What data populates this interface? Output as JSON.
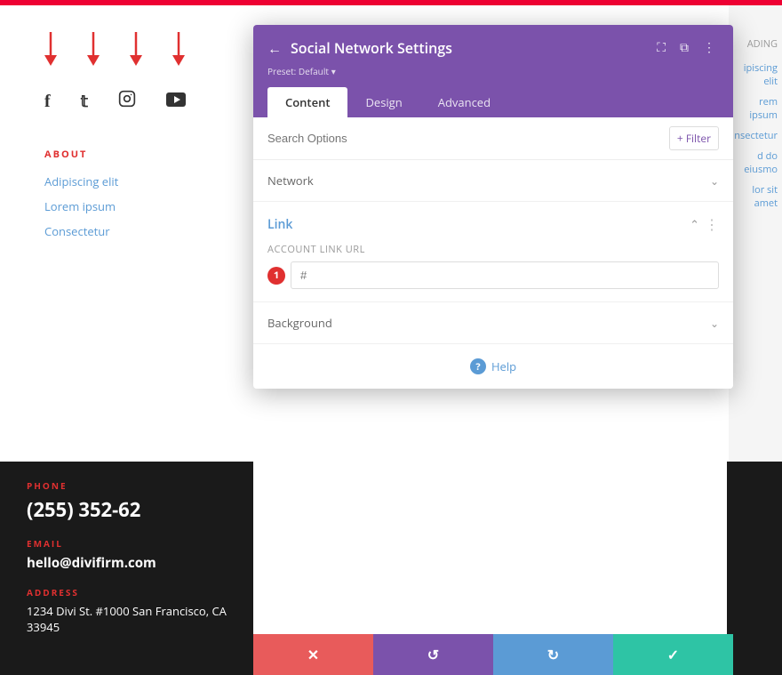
{
  "page": {
    "top_bar_color": "#e03030"
  },
  "modal": {
    "title": "Social Network Settings",
    "back_icon": "←",
    "preset_label": "Preset: Default",
    "preset_arrow": "▾",
    "header_icons": [
      "⛶",
      "⧉",
      "⋮"
    ],
    "tabs": [
      {
        "id": "content",
        "label": "Content",
        "active": true
      },
      {
        "id": "design",
        "label": "Design",
        "active": false
      },
      {
        "id": "advanced",
        "label": "Advanced",
        "active": false
      }
    ],
    "search_placeholder": "Search Options",
    "filter_label": "+ Filter",
    "sections": {
      "network": {
        "label": "Network",
        "open": false,
        "chevron": "⌄"
      },
      "link": {
        "label": "Link",
        "open": true,
        "chevron_open": "⌃",
        "more_icon": "⋮",
        "field_label": "Account Link URL",
        "field_number": "1",
        "field_value": "",
        "field_placeholder": "#"
      },
      "background": {
        "label": "Background",
        "open": false,
        "chevron": "⌄"
      }
    },
    "help_label": "Help"
  },
  "action_bar": {
    "cancel_icon": "✕",
    "undo_icon": "↺",
    "redo_icon": "↻",
    "save_icon": "✓"
  },
  "left_panel": {
    "about_title": "ABOUT",
    "links": [
      "Adipiscing elit",
      "Lorem ipsum",
      "Consectetur"
    ],
    "contact": {
      "phone_label": "PHONE",
      "phone_value": "(255) 352-62",
      "email_label": "EMAIL",
      "email_value": "hello@divifirm.com",
      "address_label": "ADDRESS",
      "address_value": "1234 Divi St. #1000 San Francisco, CA 33945"
    }
  },
  "right_panel": {
    "items": [
      "ipiscing elit",
      "rem ipsum",
      "nsectetur",
      "d do eiusmo",
      "lor sit amet"
    ]
  },
  "arrows": {
    "color": "#e03030",
    "count": 4
  },
  "social_icons": [
    "f",
    "𝕥",
    "📷",
    "▶"
  ]
}
